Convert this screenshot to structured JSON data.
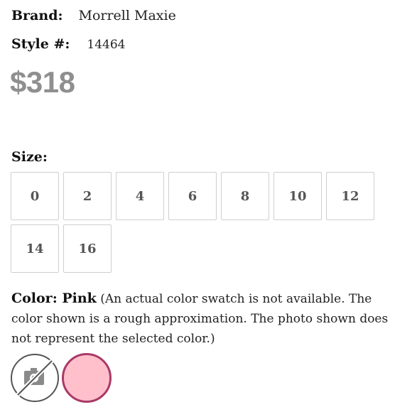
{
  "product": {
    "brand_label": "Brand:",
    "brand_value": "Morrell Maxie",
    "style_label": "Style #:",
    "style_value": "14464",
    "price": "$318"
  },
  "size": {
    "label": "Size:",
    "options": [
      "0",
      "2",
      "4",
      "6",
      "8",
      "10",
      "12",
      "14",
      "16"
    ]
  },
  "color": {
    "label": "Color: Pink",
    "note": " (An actual color swatch is not available. The color shown is a rough approximation. The photo shown does not represent the selected color.)",
    "swatches": [
      {
        "name": "no-photo",
        "icon": "camera-off-icon"
      },
      {
        "name": "Pink",
        "hex": "#ffc0cb",
        "border": "#a83a68"
      }
    ]
  },
  "colors": {
    "price": "#8f8f8f",
    "size_border": "#cfcfcf",
    "pink_swatch": "#ffc0cb",
    "pink_border": "#a83a68"
  }
}
